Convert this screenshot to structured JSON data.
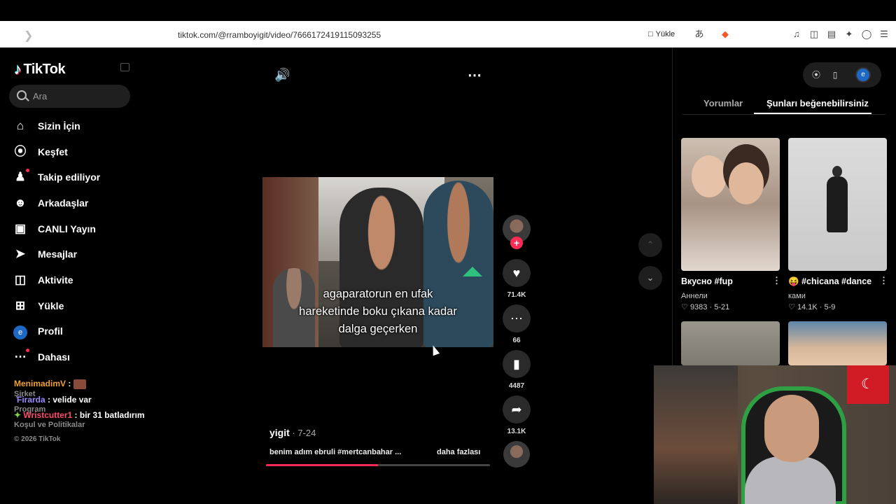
{
  "browser": {
    "url": "tiktok.com/@rramboyigit/video/7666172419115093255",
    "upload_label": "Yükle"
  },
  "sidebar": {
    "logo_text": "TikTok",
    "search_placeholder": "Ara",
    "items": [
      {
        "label": "Sizin İçin",
        "icon": "home-icon"
      },
      {
        "label": "Keşfet",
        "icon": "compass-icon"
      },
      {
        "label": "Takip ediliyor",
        "icon": "following-icon"
      },
      {
        "label": "Arkadaşlar",
        "icon": "friends-icon"
      },
      {
        "label": "CANLI Yayın",
        "icon": "live-icon"
      },
      {
        "label": "Mesajlar",
        "icon": "messages-icon"
      },
      {
        "label": "Aktivite",
        "icon": "activity-icon"
      },
      {
        "label": "Yükle",
        "icon": "upload-icon"
      },
      {
        "label": "Profil",
        "icon": "profile-avatar",
        "avatar_letter": "e"
      },
      {
        "label": "Dahası",
        "icon": "more-icon"
      }
    ],
    "footer": {
      "company": "Şirket",
      "program": "Program",
      "terms": "Koşul ve Politikalar",
      "copyright": "© 2026 TikTok"
    }
  },
  "chat_overlay": [
    {
      "user": "MenimadimV",
      "sep": " : ",
      "message": "",
      "color": "#f0a030"
    },
    {
      "user": "Firarda",
      "sep": " : ",
      "message": "velide var",
      "color": "#9b8cff"
    },
    {
      "user": "Wristcutter1",
      "sep": " : ",
      "message": "bir 31 batladırım",
      "color": "#ff4d6d",
      "badge": "✦"
    }
  ],
  "video": {
    "caption_lines": [
      "agaparatorun en ufak",
      "hareketinde boku çıkana kadar",
      "dalga geçerken"
    ],
    "author": "yigit",
    "date": " · 7-24",
    "description": "benim adım ebruli #mertcanbahar ...",
    "more_label": "daha fazlası",
    "progress": 0.5,
    "likes": "71.4K",
    "comments": "66",
    "saves": "4487",
    "shares": "13.1K"
  },
  "right_panel": {
    "tabs": [
      {
        "label": "Yorumlar",
        "active": false
      },
      {
        "label": "Şunları beğenebilirsiniz",
        "active": true
      }
    ],
    "avatar_letter": "e",
    "cards": [
      {
        "title": "Вкусно #fup",
        "author": "Аннели",
        "likes": "9383",
        "date": "5-21"
      },
      {
        "title": "#chicana #dance",
        "emoji": "😝",
        "author": "ками",
        "likes": "14.1K",
        "date": "5-9"
      }
    ]
  }
}
